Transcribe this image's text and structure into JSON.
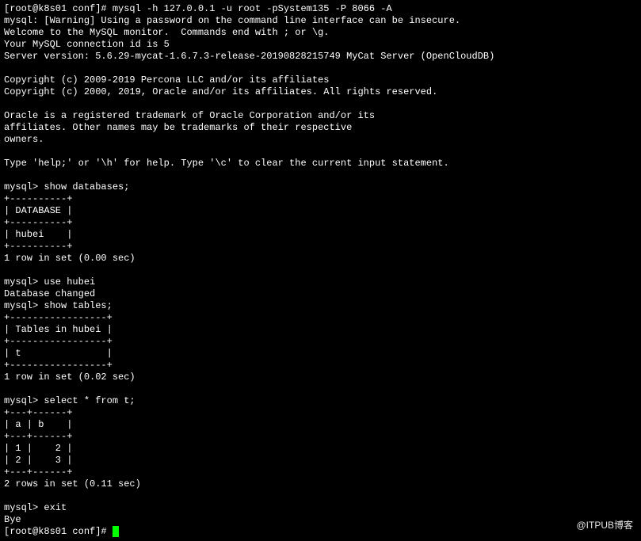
{
  "lines": [
    "[root@k8s01 conf]# mysql -h 127.0.0.1 -u root -pSystem135 -P 8066 -A",
    "mysql: [Warning] Using a password on the command line interface can be insecure.",
    "Welcome to the MySQL monitor.  Commands end with ; or \\g.",
    "Your MySQL connection id is 5",
    "Server version: 5.6.29-mycat-1.6.7.3-release-20190828215749 MyCat Server (OpenCloudDB)",
    "",
    "Copyright (c) 2009-2019 Percona LLC and/or its affiliates",
    "Copyright (c) 2000, 2019, Oracle and/or its affiliates. All rights reserved.",
    "",
    "Oracle is a registered trademark of Oracle Corporation and/or its",
    "affiliates. Other names may be trademarks of their respective",
    "owners.",
    "",
    "Type 'help;' or '\\h' for help. Type '\\c' to clear the current input statement.",
    "",
    "mysql> show databases;",
    "+----------+",
    "| DATABASE |",
    "+----------+",
    "| hubei    |",
    "+----------+",
    "1 row in set (0.00 sec)",
    "",
    "mysql> use hubei",
    "Database changed",
    "mysql> show tables;",
    "+-----------------+",
    "| Tables in hubei |",
    "+-----------------+",
    "| t               |",
    "+-----------------+",
    "1 row in set (0.02 sec)",
    "",
    "mysql> select * from t;",
    "+---+------+",
    "| a | b    |",
    "+---+------+",
    "| 1 |    2 |",
    "| 2 |    3 |",
    "+---+------+",
    "2 rows in set (0.11 sec)",
    "",
    "mysql> exit",
    "Bye",
    "[root@k8s01 conf]# "
  ],
  "watermark": "@ITPUB博客"
}
